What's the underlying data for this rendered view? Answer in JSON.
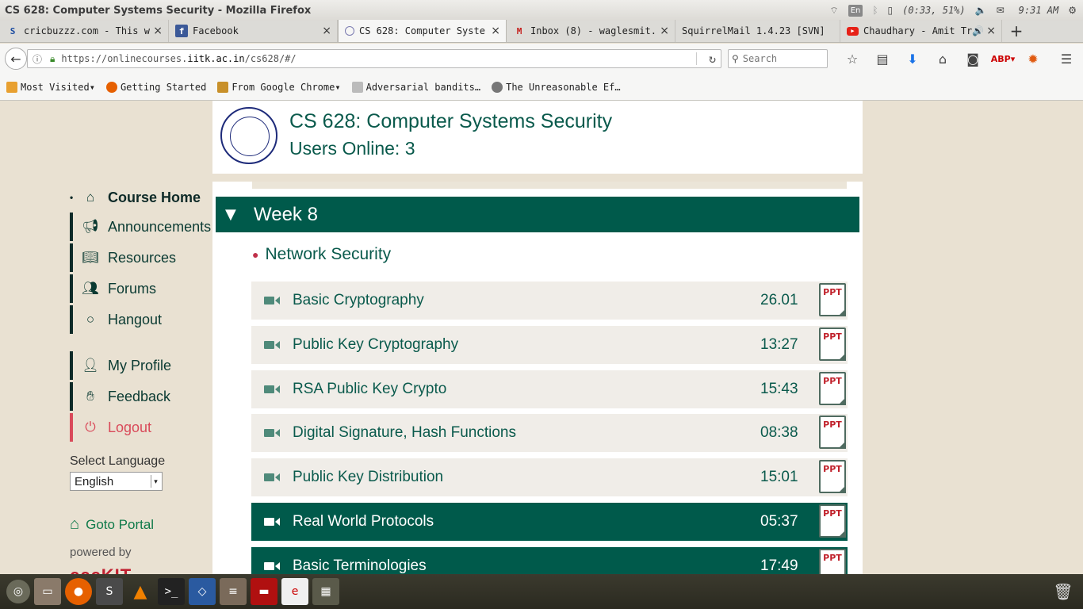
{
  "window": {
    "title": "CS 628: Computer Systems Security - Mozilla Firefox"
  },
  "tray": {
    "lang": "En",
    "battery": "(0:33, 51%)",
    "clock": "9:31 AM"
  },
  "tabs": [
    {
      "label": "cricbuzzz.com - This w",
      "icon": "cricbuzz-icon"
    },
    {
      "label": "Facebook",
      "icon": "facebook-icon"
    },
    {
      "label": "CS 628: Computer Syste",
      "icon": "course-icon"
    },
    {
      "label": "Inbox (8) - waglesmit.",
      "icon": "gmail-icon"
    },
    {
      "label": "SquirrelMail 1.4.23 [SVN]",
      "icon": "mail-icon"
    },
    {
      "label": "Chaudhary - Amit Tr",
      "icon": "youtube-icon"
    }
  ],
  "url": {
    "prefix": "https://onlinecourses.",
    "domain": "iitk.ac.in",
    "path": "/cs628/#/"
  },
  "search": {
    "placeholder": "Search"
  },
  "bookmarks": [
    {
      "label": "Most Visited"
    },
    {
      "label": "Getting Started"
    },
    {
      "label": "From Google Chrome"
    },
    {
      "label": "Adversarial bandits…"
    },
    {
      "label": "The Unreasonable Ef…"
    }
  ],
  "header": {
    "title": "CS 628: Computer Systems Security",
    "users_online": "Users Online: 3"
  },
  "sidebar": {
    "items": [
      {
        "label": "Course Home"
      },
      {
        "label": "Announcements"
      },
      {
        "label": "Resources"
      },
      {
        "label": "Forums"
      },
      {
        "label": "Hangout"
      },
      {
        "label": "My Profile"
      },
      {
        "label": "Feedback"
      },
      {
        "label": "Logout"
      }
    ],
    "select_language_label": "Select Language",
    "language": "English",
    "goto_portal": "Goto Portal",
    "powered_by": "powered by",
    "brand": "cccKIT"
  },
  "week": {
    "label": "Week 8"
  },
  "topic": {
    "label": "Network Security"
  },
  "lectures": [
    {
      "name": "Basic Cryptography",
      "duration": "26.01",
      "badge": "PPT"
    },
    {
      "name": "Public Key Cryptography",
      "duration": "13:27",
      "badge": "PPT"
    },
    {
      "name": "RSA Public Key Crypto",
      "duration": "15:43",
      "badge": "PPT"
    },
    {
      "name": "Digital Signature, Hash Functions",
      "duration": "08:38",
      "badge": "PPT"
    },
    {
      "name": "Public Key Distribution",
      "duration": "15:01",
      "badge": "PPT"
    },
    {
      "name": "Real World Protocols",
      "duration": "05:37",
      "badge": "PPT"
    },
    {
      "name": "Basic Terminologies",
      "duration": "17:49",
      "badge": "PPT"
    }
  ],
  "colors": {
    "accent": "#005a4b",
    "text": "#0a5a4c",
    "logout": "#d94a5a",
    "ppt": "#c0202a"
  }
}
